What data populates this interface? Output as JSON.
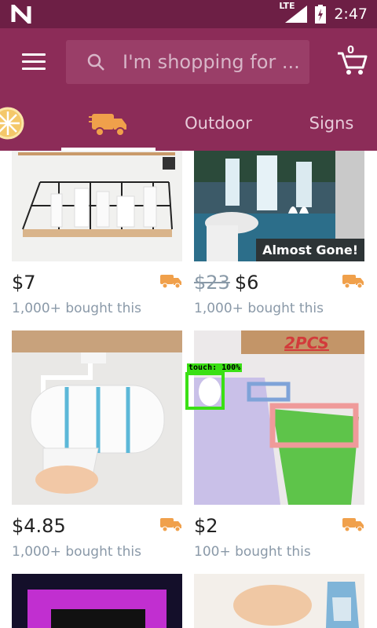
{
  "status_bar": {
    "network": "LTE",
    "time": "2:47"
  },
  "header": {
    "search_placeholder": "I'm shopping for ...",
    "cart_count": "0"
  },
  "tabs": [
    {
      "label": ""
    },
    {
      "label": ""
    },
    {
      "label": "Outdoor"
    },
    {
      "label": "Signs"
    }
  ],
  "products": [
    {
      "price": "$7",
      "old_price": "",
      "bought": "1,000+ bought this",
      "badge": ""
    },
    {
      "price": "$6",
      "old_price": "$23",
      "bought": "1,000+ bought this",
      "badge": "Almost Gone!"
    },
    {
      "price": "$4.85",
      "old_price": "",
      "bought": "1,000+ bought this",
      "badge": ""
    },
    {
      "price": "$2",
      "old_price": "",
      "bought": "100+ bought this",
      "badge": "",
      "image_text": "2PCS"
    }
  ],
  "overlay": {
    "touch_label": "touch: 100%"
  },
  "colors": {
    "status_bar": "#6d1f45",
    "app_bar": "#8c2c58",
    "truck": "#f0a04b",
    "touch": "#3ae014"
  }
}
